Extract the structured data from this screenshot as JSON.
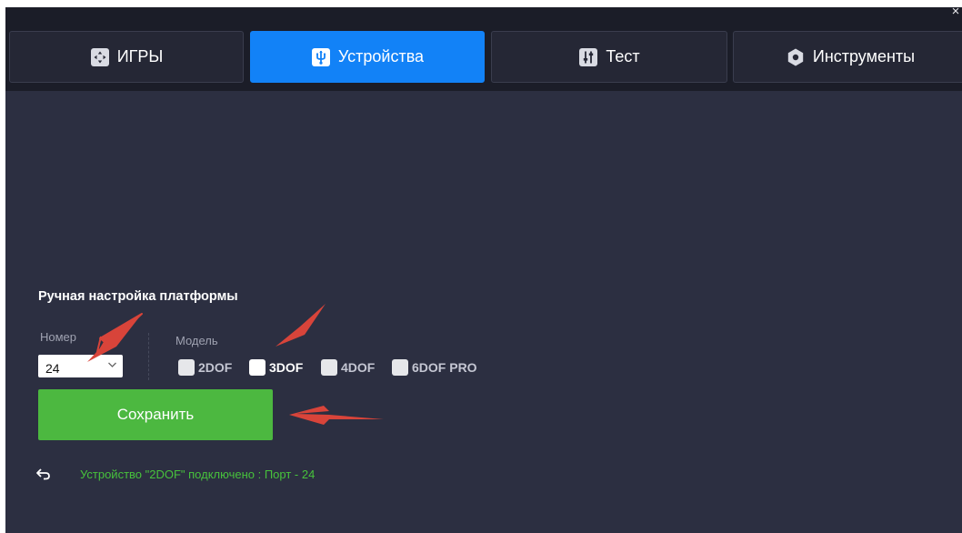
{
  "window": {
    "close_glyph": "×"
  },
  "tabs": [
    {
      "label": "ИГРЫ",
      "icon": "gamepad-icon",
      "active": false
    },
    {
      "label": "Устройства",
      "icon": "usb-icon",
      "active": true
    },
    {
      "label": "Тест",
      "icon": "sliders-icon",
      "active": false
    },
    {
      "label": "Инструменты",
      "icon": "gear-icon",
      "active": false
    }
  ],
  "manual_setup": {
    "title": "Ручная настройка платформы",
    "number_label": "Номер",
    "number_value": "24",
    "model_label": "Модель",
    "models": [
      {
        "label": "2DOF",
        "checked": false
      },
      {
        "label": "3DOF",
        "checked": true
      },
      {
        "label": "4DOF",
        "checked": false
      },
      {
        "label": "6DOF PRO",
        "checked": false
      }
    ],
    "save_label": "Сохранить"
  },
  "status": {
    "text": "Устройство \"2DOF\" подключено : Порт - 24",
    "back_icon": "back-arrow-icon"
  },
  "colors": {
    "background": "#2c2f41",
    "tab_bar": "#1b1d28",
    "tab": "#252735",
    "accent_blue": "#1282f7",
    "save_green": "#4cb840",
    "status_green": "#47c23c",
    "annotation_red": "#d8443a"
  }
}
